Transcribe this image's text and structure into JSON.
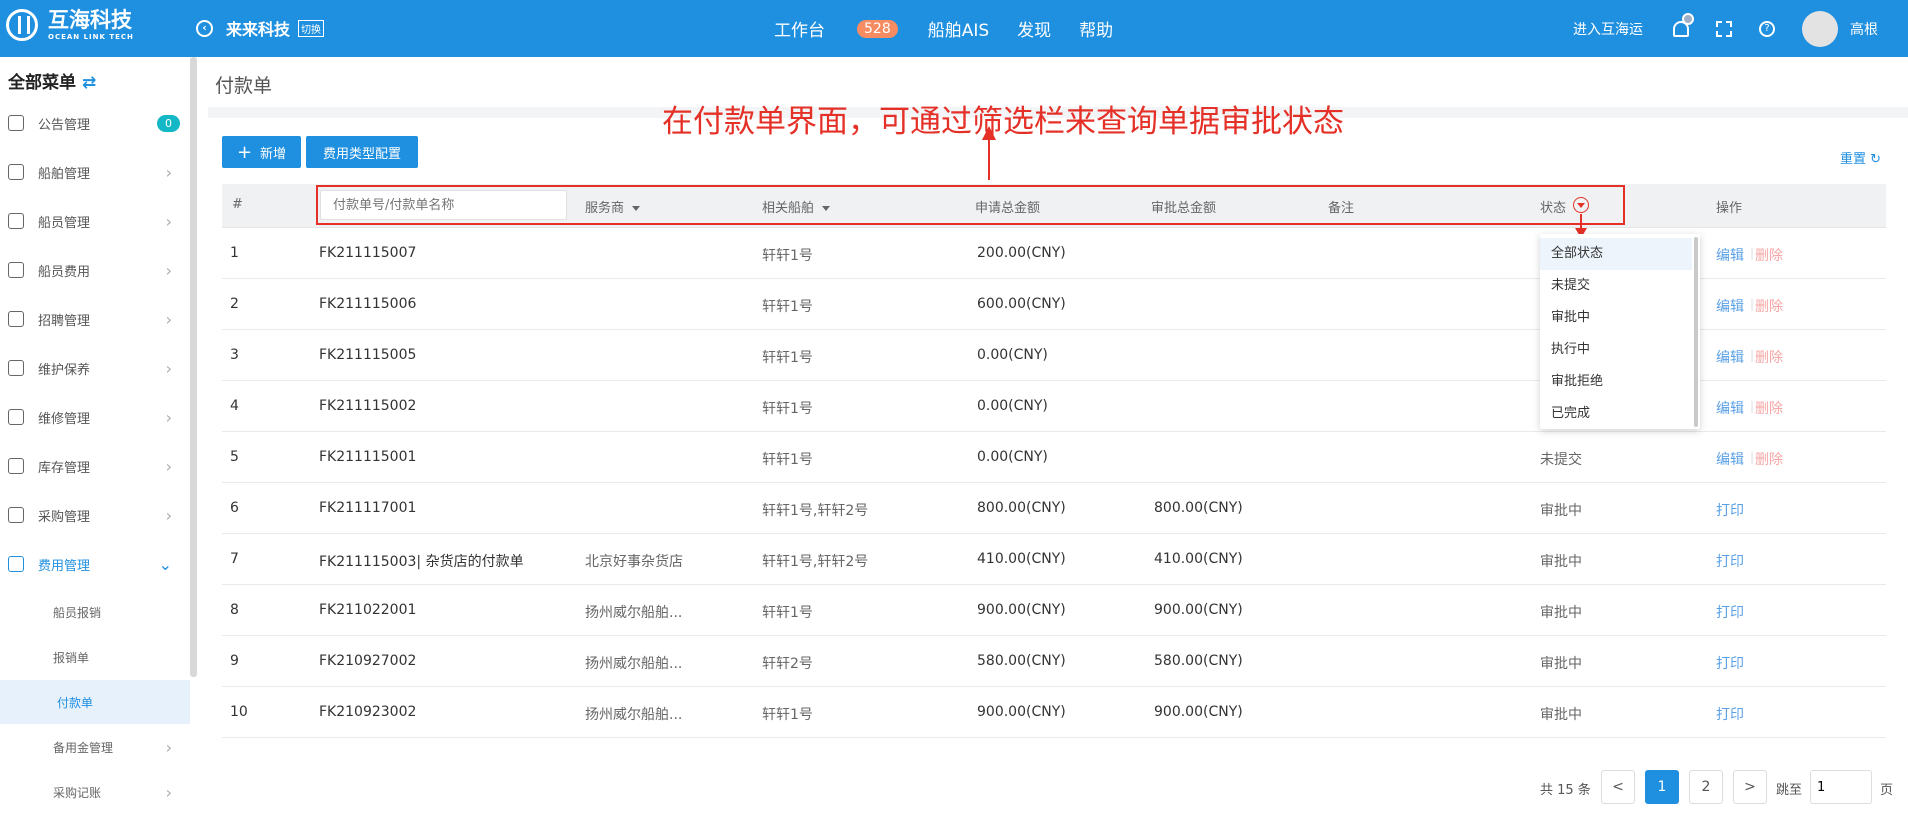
{
  "header": {
    "logo_cn": "互海科技",
    "logo_en": "OCEAN LINK TECH",
    "company": "来来科技",
    "switch_label": "切换",
    "nav": [
      {
        "label": "工作台",
        "badge": "528"
      },
      {
        "label": "船舶AIS"
      },
      {
        "label": "发现"
      },
      {
        "label": "帮助"
      }
    ],
    "enter_label": "进入互海运",
    "user_name": "高根",
    "help_icon_text": "?"
  },
  "sidebar": {
    "title": "全部菜单",
    "swap_glyph": "⇄",
    "items": [
      {
        "label": "公告管理",
        "count": "0"
      },
      {
        "label": "船舶管理"
      },
      {
        "label": "船员管理"
      },
      {
        "label": "船员费用"
      },
      {
        "label": "招聘管理"
      },
      {
        "label": "维护保养"
      },
      {
        "label": "维修管理"
      },
      {
        "label": "库存管理"
      },
      {
        "label": "采购管理"
      },
      {
        "label": "费用管理"
      }
    ],
    "subitems": [
      {
        "label": "船员报销"
      },
      {
        "label": "报销单"
      },
      {
        "label": "付款单"
      },
      {
        "label": "备用金管理"
      },
      {
        "label": "采购记账"
      }
    ],
    "chevron": "›",
    "chevron_down": "⌄"
  },
  "page": {
    "title": "付款单",
    "annotation": "在付款单界面，可通过筛选栏来查询单据审批状态",
    "add_label": "新增",
    "add_plus": "+",
    "cfg_label": "费用类型配置",
    "reset_label": "重置 ↻"
  },
  "table": {
    "col_index": "#",
    "search_placeholder": "付款单号/付款单名称",
    "col_vendor": "服务商",
    "col_ship": "相关船舶",
    "col_apply": "申请总金额",
    "col_approve": "审批总金额",
    "col_note": "备注",
    "col_status": "状态",
    "col_ops": "操作",
    "rows": [
      {
        "idx": "1",
        "no": "FK211115007",
        "vendor": "",
        "ship": "轩轩1号",
        "apply": "200.00(CNY)",
        "approve": "",
        "status": "",
        "op1": "编辑",
        "sep": "|",
        "op2": "删除"
      },
      {
        "idx": "2",
        "no": "FK211115006",
        "vendor": "",
        "ship": "轩轩1号",
        "apply": "600.00(CNY)",
        "approve": "",
        "status": "",
        "op1": "编辑",
        "sep": "|",
        "op2": "删除"
      },
      {
        "idx": "3",
        "no": "FK211115005",
        "vendor": "",
        "ship": "轩轩1号",
        "apply": "0.00(CNY)",
        "approve": "",
        "status": "",
        "op1": "编辑",
        "sep": "|",
        "op2": "删除"
      },
      {
        "idx": "4",
        "no": "FK211115002",
        "vendor": "",
        "ship": "轩轩1号",
        "apply": "0.00(CNY)",
        "approve": "",
        "status": "",
        "op1": "编辑",
        "sep": "|",
        "op2": "删除"
      },
      {
        "idx": "5",
        "no": "FK211115001",
        "vendor": "",
        "ship": "轩轩1号",
        "apply": "0.00(CNY)",
        "approve": "",
        "status": "未提交",
        "op1": "编辑",
        "sep": "|",
        "op2": "删除"
      },
      {
        "idx": "6",
        "no": "FK211117001",
        "vendor": "",
        "ship": "轩轩1号,轩轩2号",
        "apply": "800.00(CNY)",
        "approve": "800.00(CNY)",
        "status": "审批中",
        "op1": "打印"
      },
      {
        "idx": "7",
        "no": "FK211115003| 杂货店的付款单",
        "vendor": "北京好事杂货店",
        "ship": "轩轩1号,轩轩2号",
        "apply": "410.00(CNY)",
        "approve": "410.00(CNY)",
        "status": "审批中",
        "op1": "打印"
      },
      {
        "idx": "8",
        "no": "FK211022001",
        "vendor": "扬州威尔船舶...",
        "ship": "轩轩1号",
        "apply": "900.00(CNY)",
        "approve": "900.00(CNY)",
        "status": "审批中",
        "op1": "打印"
      },
      {
        "idx": "9",
        "no": "FK210927002",
        "vendor": "扬州威尔船舶...",
        "ship": "轩轩2号",
        "apply": "580.00(CNY)",
        "approve": "580.00(CNY)",
        "status": "审批中",
        "op1": "打印"
      },
      {
        "idx": "10",
        "no": "FK210923002",
        "vendor": "扬州威尔船舶...",
        "ship": "轩轩1号",
        "apply": "900.00(CNY)",
        "approve": "900.00(CNY)",
        "status": "审批中",
        "op1": "打印"
      }
    ]
  },
  "status_dropdown": {
    "options": [
      "全部状态",
      "未提交",
      "审批中",
      "执行中",
      "审批拒绝",
      "已完成"
    ],
    "selected": "全部状态"
  },
  "pagination": {
    "total_label": "共 15 条",
    "prev": "<",
    "pages": [
      "1",
      "2"
    ],
    "current": "1",
    "next": ">",
    "jump_label": "跳至",
    "jump_value": "1",
    "page_suffix": "页"
  },
  "colors": {
    "primary": "#1f8fe0",
    "annotation": "#e53027",
    "link": "#5aa0e6",
    "delete": "#f6a6a6",
    "badge": "#f78b62"
  }
}
